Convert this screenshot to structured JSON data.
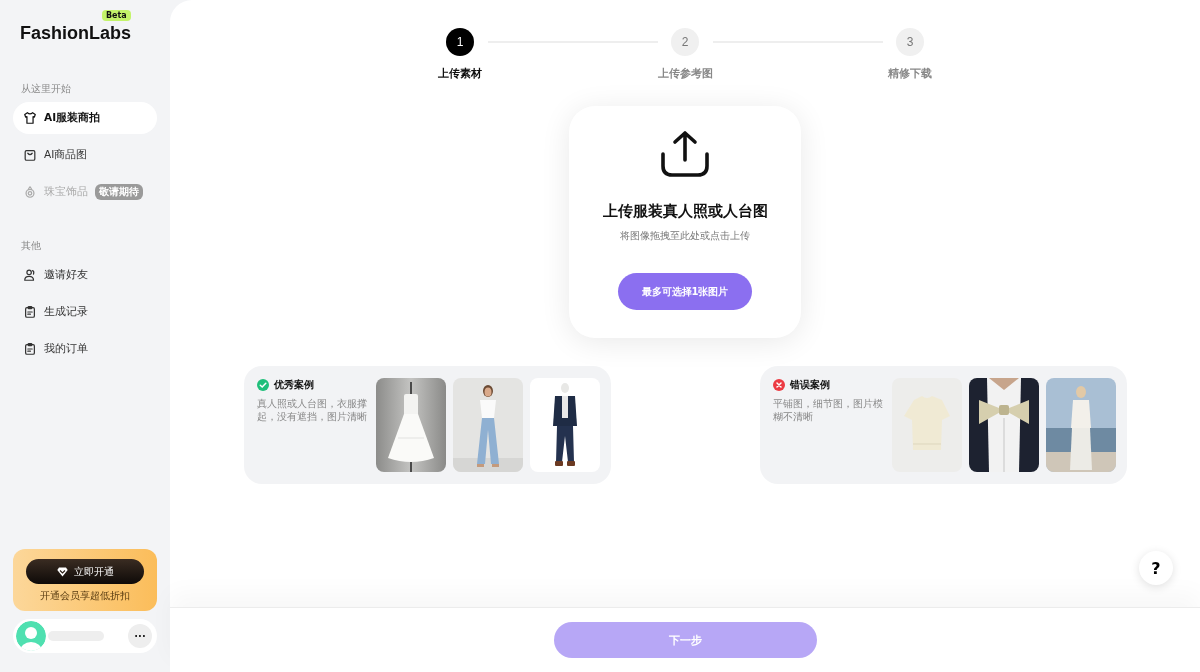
{
  "sidebar": {
    "logo": "FashionLabs",
    "logo_badge": "Beta",
    "sections": [
      {
        "label": "从这里开始",
        "items": [
          {
            "label": "AI服装商拍",
            "selected": true,
            "disabled": false
          },
          {
            "label": "AI商品图",
            "selected": false,
            "disabled": false
          },
          {
            "label": "珠宝饰品",
            "selected": false,
            "disabled": true,
            "badge": "敬请期待"
          }
        ]
      },
      {
        "label": "其他",
        "items": [
          {
            "label": "邀请好友",
            "selected": false,
            "disabled": false
          },
          {
            "label": "生成记录",
            "selected": false,
            "disabled": false
          },
          {
            "label": "我的订单",
            "selected": false,
            "disabled": false
          }
        ]
      }
    ],
    "membership": {
      "button": "立即开通",
      "caption": "开通会员享超低折扣"
    },
    "user": {
      "more": "···"
    }
  },
  "steps": [
    {
      "number": "1",
      "label": "上传素材",
      "selected": true
    },
    {
      "number": "2",
      "label": "上传参考图",
      "selected": false
    },
    {
      "number": "3",
      "label": "精修下载",
      "selected": false
    }
  ],
  "upload": {
    "title": "上传服装真人照或人台图",
    "hint": "将图像拖拽至此处或点击上传",
    "button": "最多可选择1张图片"
  },
  "examples": [
    {
      "kind": "good",
      "title": "优秀案例",
      "description": "真人照或人台图，衣服撑起，没有遮挡，图片清晰"
    },
    {
      "kind": "bad",
      "title": "错误案例",
      "description": "平铺图，细节图，图片模糊不清晰"
    }
  ],
  "help": "?",
  "next_button": {
    "label": "下一步",
    "disabled": true
  }
}
